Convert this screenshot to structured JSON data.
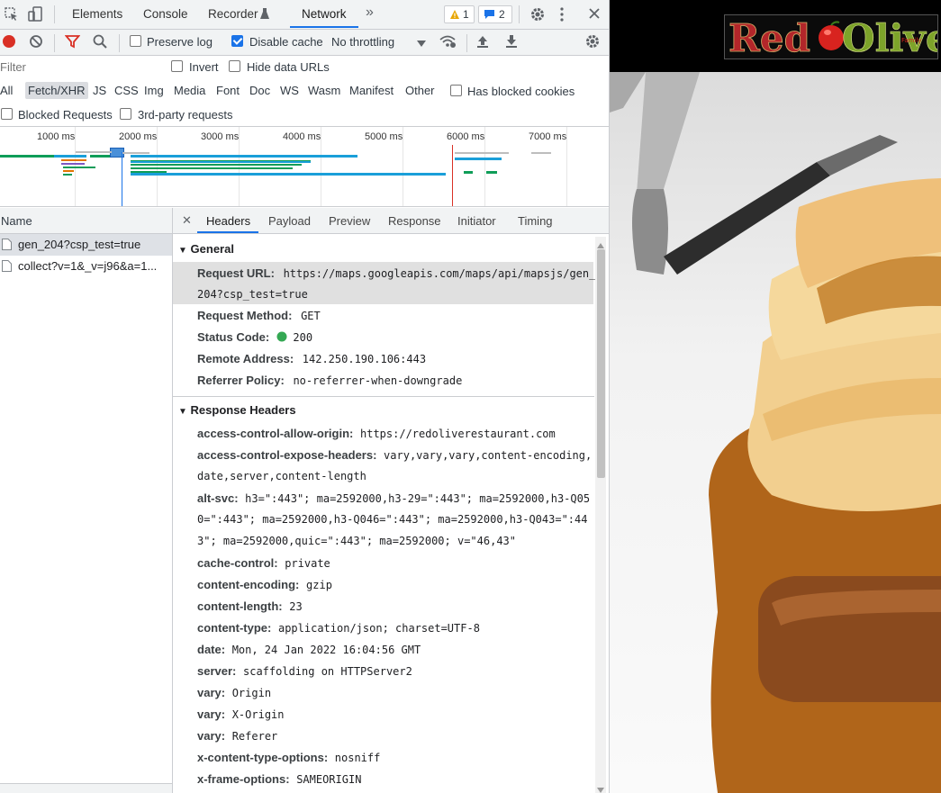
{
  "toolbar": {
    "tabs": [
      "Elements",
      "Console",
      "Recorder",
      "Network"
    ],
    "more": "»",
    "warn_count": "1",
    "msg_count": "2"
  },
  "netbar": {
    "preserve_log": "Preserve log",
    "disable_cache": "Disable cache",
    "throttling": "No throttling"
  },
  "filterbar": {
    "placeholder": "Filter",
    "invert": "Invert",
    "hide_data_urls": "Hide data URLs"
  },
  "types": [
    "All",
    "Fetch/XHR",
    "JS",
    "CSS",
    "Img",
    "Media",
    "Font",
    "Doc",
    "WS",
    "Wasm",
    "Manifest",
    "Other"
  ],
  "has_blocked_cookies": "Has blocked cookies",
  "blocked_requests": "Blocked Requests",
  "third_party": "3rd-party requests",
  "timeline": {
    "labels": [
      "1000 ms",
      "2000 ms",
      "3000 ms",
      "4000 ms",
      "5000 ms",
      "6000 ms",
      "7000 ms"
    ]
  },
  "requests": {
    "header": "Name",
    "items": [
      "gen_204?csp_test=true",
      "collect?v=1&_v=j96&a=1..."
    ]
  },
  "details": {
    "close": "✕",
    "tabs": [
      "Headers",
      "Payload",
      "Preview",
      "Response",
      "Initiator",
      "Timing"
    ],
    "general": {
      "title": "General",
      "request_url_label": "Request URL:",
      "request_url_1": "https://maps.googleapis.com/maps/api/mapsjs/gen_",
      "request_url_2": "204?csp_test=true",
      "method_label": "Request Method:",
      "method": "GET",
      "status_label": "Status Code:",
      "status": "200",
      "remote_label": "Remote Address:",
      "remote": "142.250.190.106:443",
      "referrer_label": "Referrer Policy:",
      "referrer": "no-referrer-when-downgrade"
    },
    "response": {
      "title": "Response Headers",
      "acao_label": "access-control-allow-origin:",
      "acao": "https://redoliverestaurant.com",
      "aceh_label": "access-control-expose-headers:",
      "aceh_1": "vary,vary,vary,content-encoding,",
      "aceh_2": "date,server,content-length",
      "altsvc_label": "alt-svc:",
      "altsvc_1": "h3=\":443\"; ma=2592000,h3-29=\":443\"; ma=2592000,h3-Q05",
      "altsvc_2": "0=\":443\"; ma=2592000,h3-Q046=\":443\"; ma=2592000,h3-Q043=\":44",
      "altsvc_3": "3\"; ma=2592000,quic=\":443\"; ma=2592000; v=\"46,43\"",
      "headers": [
        {
          "name": "cache-control:",
          "value": "private"
        },
        {
          "name": "content-encoding:",
          "value": "gzip"
        },
        {
          "name": "content-length:",
          "value": "23"
        },
        {
          "name": "content-type:",
          "value": "application/json; charset=UTF-8"
        },
        {
          "name": "date:",
          "value": "Mon, 24 Jan 2022 16:04:56 GMT"
        },
        {
          "name": "server:",
          "value": "scaffolding on HTTPServer2"
        },
        {
          "name": "vary:",
          "value": "Origin"
        },
        {
          "name": "vary:",
          "value": "X-Origin"
        },
        {
          "name": "vary:",
          "value": "Referer"
        },
        {
          "name": "x-content-type-options:",
          "value": "nosniff"
        },
        {
          "name": "x-frame-options:",
          "value": "SAMEORIGIN"
        }
      ]
    }
  },
  "website": {
    "logo_red": "Red",
    "logo_olive": "Olive",
    "logo_small": "Family"
  }
}
